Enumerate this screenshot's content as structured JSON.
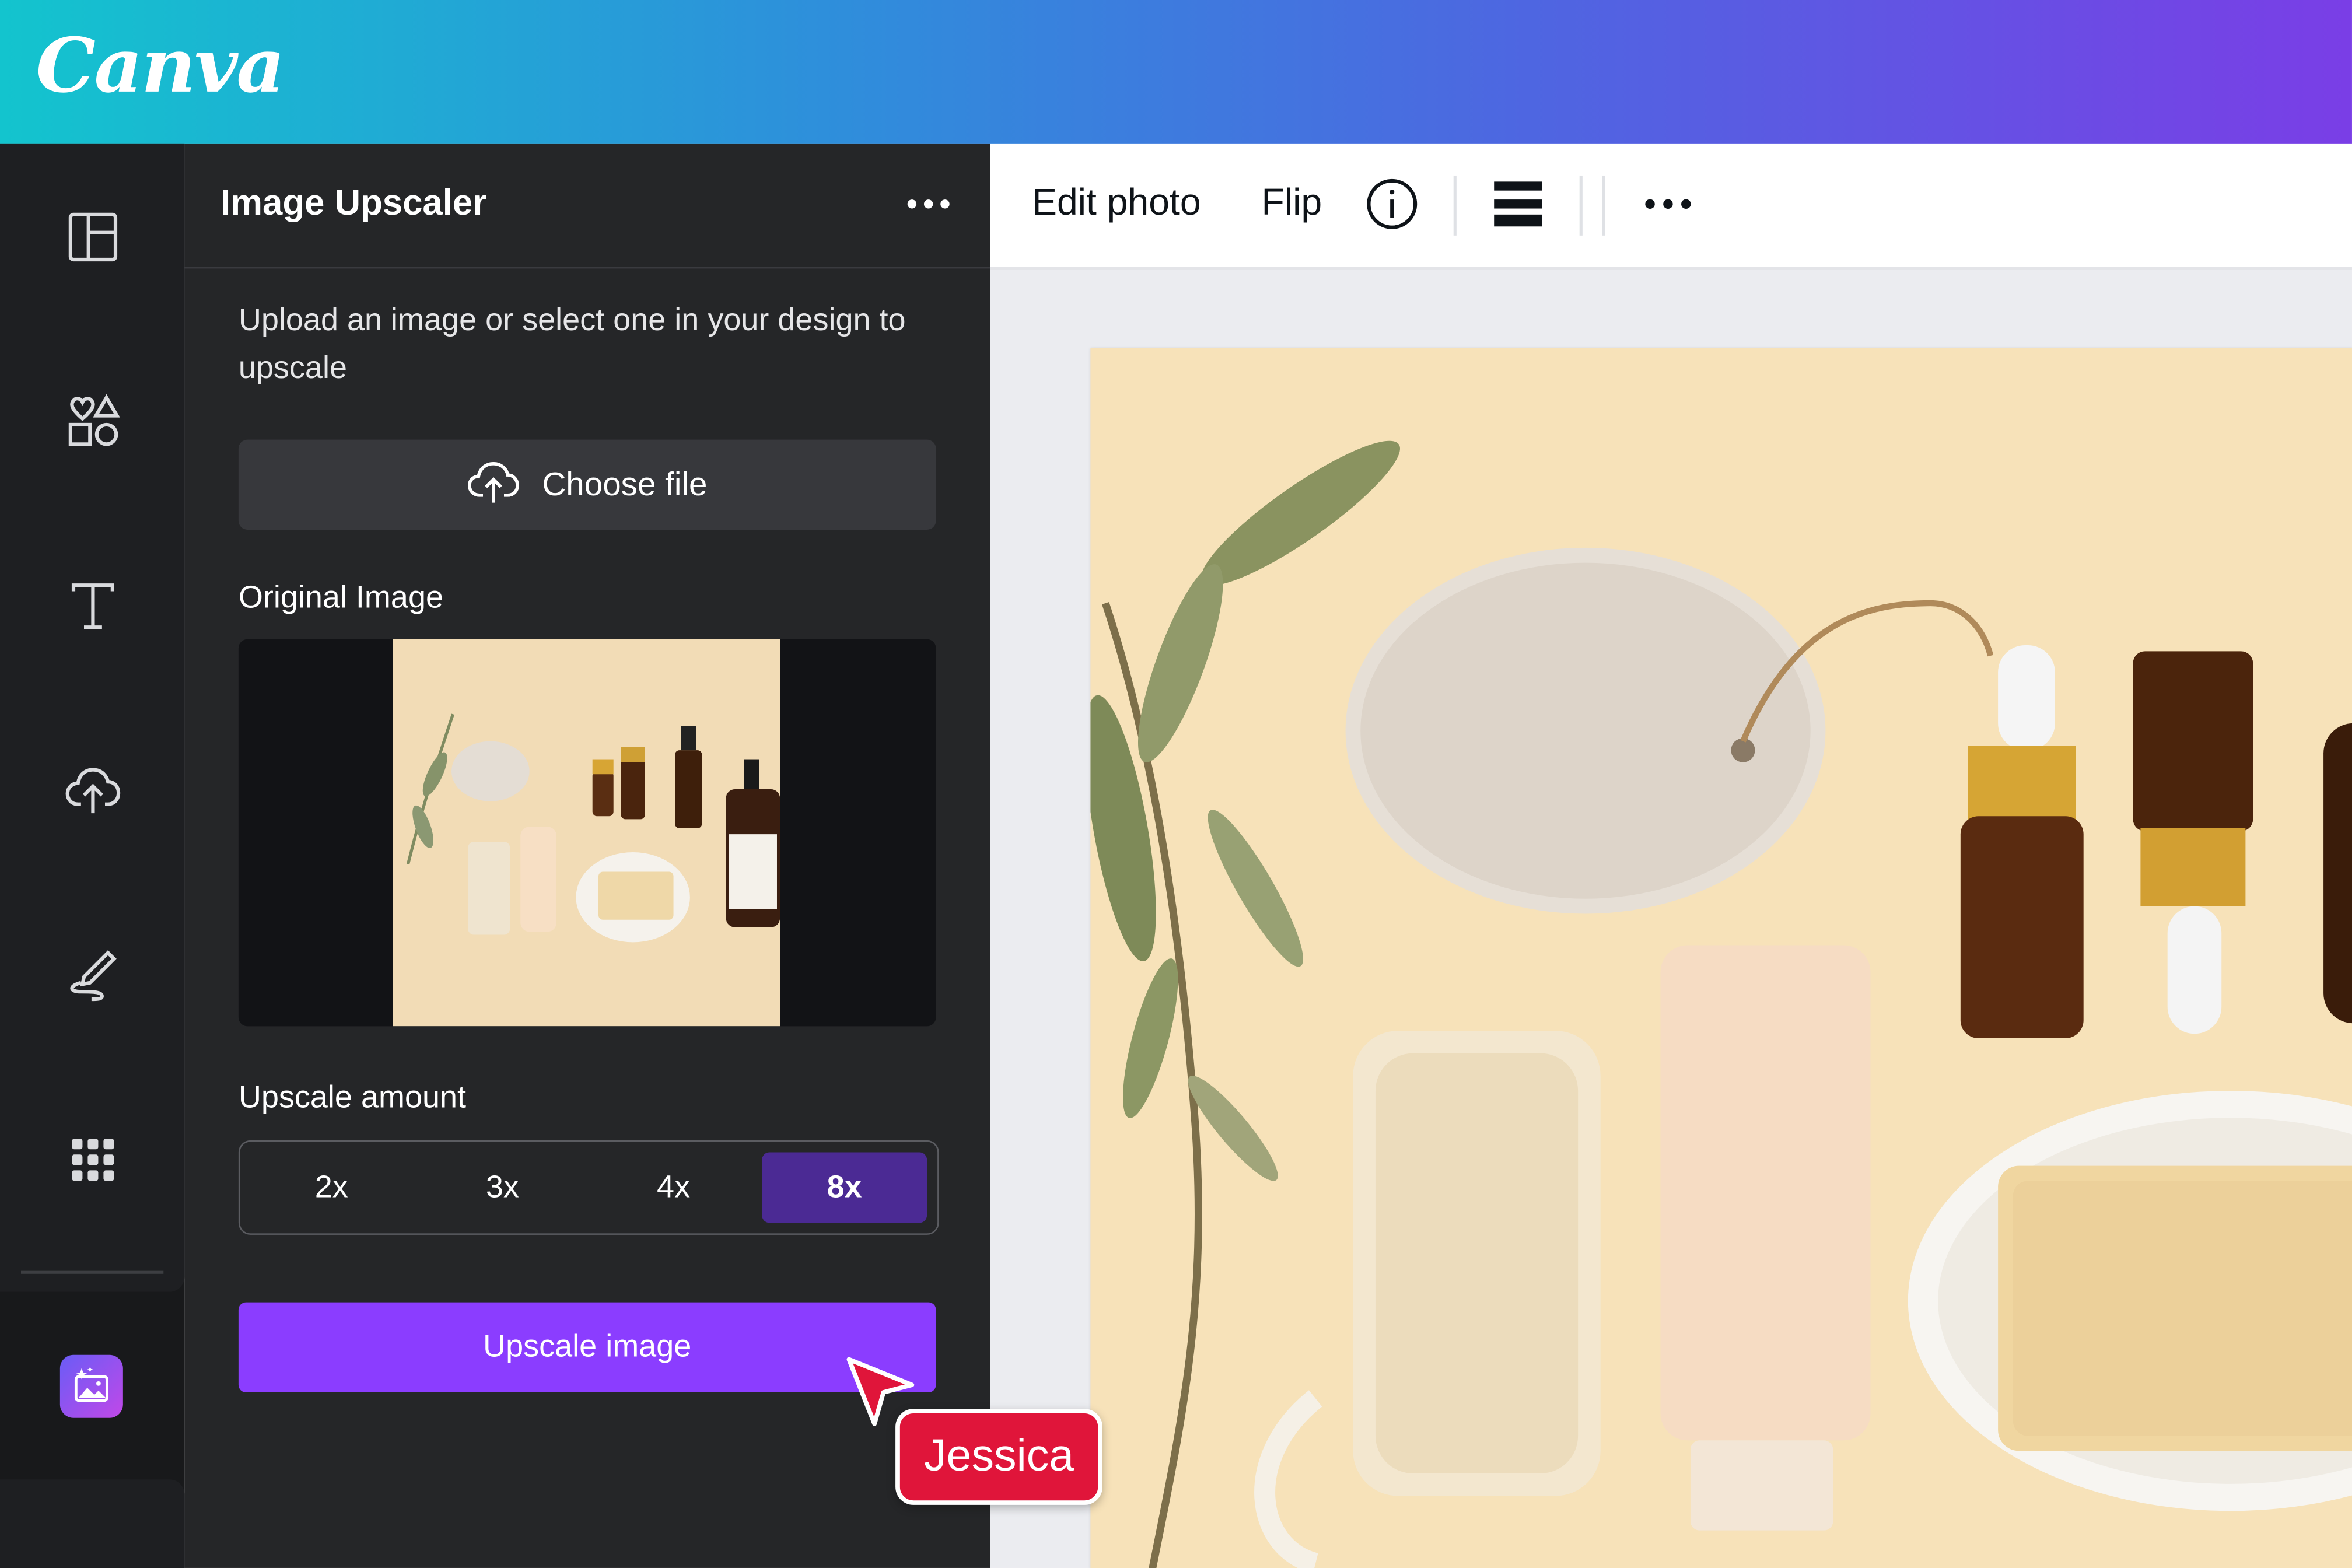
{
  "app": {
    "brand": "Canva"
  },
  "panel": {
    "title": "Image Upscaler",
    "description": "Upload an image or select one in your design to upscale",
    "choose_file": "Choose file",
    "original_image_label": "Original Image",
    "upscale_amount_label": "Upscale amount",
    "options": [
      "2x",
      "3x",
      "4x",
      "8x"
    ],
    "selected_option": "8x",
    "upscale_button": "Upscale image"
  },
  "toolbar": {
    "edit_photo": "Edit photo",
    "flip": "Flip"
  },
  "collaborator": {
    "name": "Jessica"
  },
  "colors": {
    "accent": "#8b3dff",
    "selected": "#4b2a94",
    "collaborator": "#e0153a"
  }
}
